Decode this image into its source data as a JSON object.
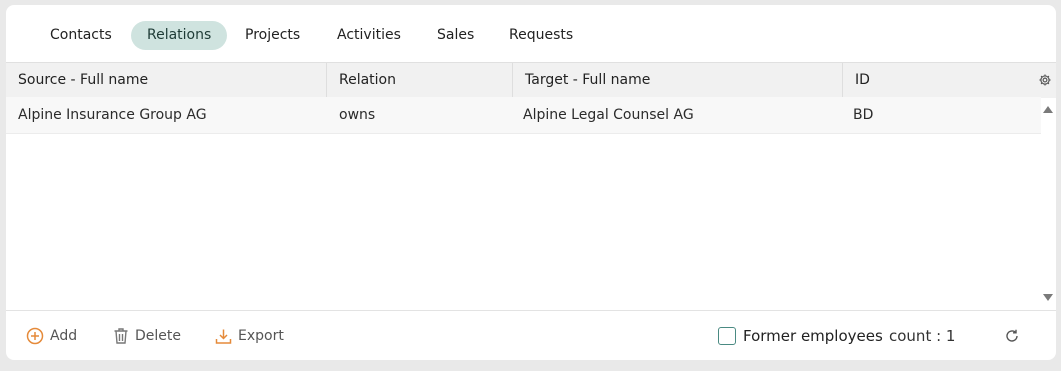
{
  "tabs": [
    {
      "label": "Contacts",
      "active": false
    },
    {
      "label": "Relations",
      "active": true
    },
    {
      "label": "Projects",
      "active": false
    },
    {
      "label": "Activities",
      "active": false
    },
    {
      "label": "Sales",
      "active": false
    },
    {
      "label": "Requests",
      "active": false
    }
  ],
  "table": {
    "columns": [
      "Source - Full name",
      "Relation",
      "Target - Full name",
      "ID"
    ],
    "rows": [
      [
        "Alpine Insurance Group AG",
        "owns",
        "Alpine Legal Counsel AG",
        "BD"
      ]
    ],
    "settings_icon": "gear-icon"
  },
  "footer": {
    "add_label": "Add",
    "delete_label": "Delete",
    "export_label": "Export",
    "former_employees_label": "Former employees",
    "former_employees_checked": false,
    "count_label": "count : 1"
  },
  "colors": {
    "active_tab_bg": "#cfe3df",
    "add_icon": "#e58a3a",
    "export_icon": "#e58a3a",
    "checkbox_border": "#4a8a82"
  }
}
